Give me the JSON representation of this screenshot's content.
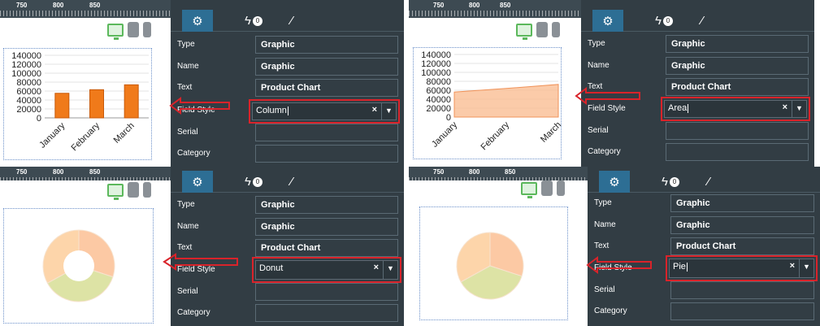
{
  "rulers": [
    {
      "t1": "750",
      "t2": "800",
      "t3": "850"
    },
    {
      "t1": "750",
      "t2": "800",
      "t3": "850"
    },
    {
      "t1": "750",
      "t2": "800",
      "t3": "850"
    },
    {
      "t1": "750",
      "t2": "800",
      "t3": "850"
    }
  ],
  "tabs": {
    "badge": "0"
  },
  "panel": {
    "type_label": "Type",
    "type_value": "Graphic",
    "name_label": "Name",
    "name_value": "Graphic",
    "text_label": "Text",
    "text_value": "Product Chart",
    "fieldstyle_label": "Field Style",
    "serial_label": "Serial",
    "category_label": "Category",
    "clear_symbol": "×",
    "dropdown_symbol": "▼"
  },
  "field_styles": [
    "Column",
    "Area",
    "Donut",
    "Pie"
  ],
  "chart_data": [
    {
      "type": "bar",
      "categories": [
        "January",
        "February",
        "March"
      ],
      "values": [
        55000,
        63000,
        74000
      ],
      "yticks": [
        "140000",
        "120000",
        "100000",
        "80000",
        "60000",
        "40000",
        "20000",
        "0"
      ],
      "ylim": [
        0,
        140000
      ],
      "color": "#f07a1a"
    },
    {
      "type": "area",
      "categories": [
        "January",
        "February",
        "March"
      ],
      "values": [
        56000,
        64000,
        73000
      ],
      "yticks": [
        "140000",
        "120000",
        "100000",
        "80000",
        "60000",
        "40000",
        "20000",
        "0"
      ],
      "ylim": [
        0,
        140000
      ],
      "color": "#f9b98c"
    },
    {
      "type": "pie",
      "style": "donut",
      "values": [
        30,
        37,
        33
      ],
      "colors": [
        "#fcc9a4",
        "#dde3a5",
        "#fdd5aa"
      ]
    },
    {
      "type": "pie",
      "style": "pie",
      "values": [
        30,
        37,
        33
      ],
      "colors": [
        "#fcc9a4",
        "#dde3a5",
        "#fdd5aa"
      ]
    }
  ]
}
